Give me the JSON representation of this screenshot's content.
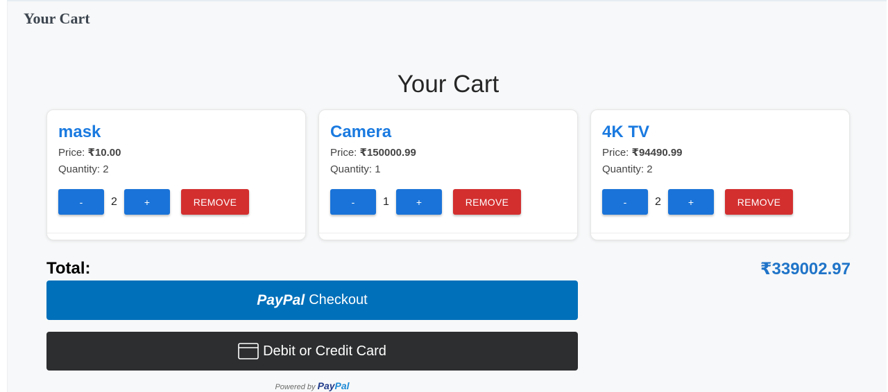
{
  "window": {
    "title": "Your Cart"
  },
  "page": {
    "heading": "Your Cart"
  },
  "labels": {
    "price": "Price:",
    "quantity": "Quantity:",
    "minus": "-",
    "plus": "+",
    "remove": "REMOVE"
  },
  "cart": {
    "items": [
      {
        "name": "mask",
        "price": "₹10.00",
        "quantity": "2"
      },
      {
        "name": "Camera",
        "price": "₹150000.99",
        "quantity": "1"
      },
      {
        "name": "4K TV",
        "price": "₹94490.99",
        "quantity": "2"
      }
    ]
  },
  "summary": {
    "total_label": "Total:",
    "total_value": "₹339002.97"
  },
  "checkout": {
    "paypal_logo": "PayPal",
    "paypal_label": "Checkout",
    "card_label": "Debit or Credit Card",
    "powered_by": "Powered by",
    "powered_logo_pay": "Pay",
    "powered_logo_pal": "Pal"
  },
  "colors": {
    "accent": "#1a73d8",
    "danger": "#d32f2f",
    "paypal_blue": "#0070ba",
    "card_button": "#2c2e2f"
  },
  "icons": {
    "card": "credit-card-icon"
  }
}
